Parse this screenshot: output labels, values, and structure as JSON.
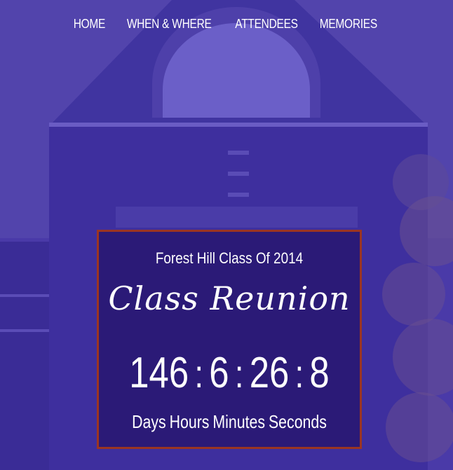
{
  "nav": {
    "items": [
      {
        "label": "HOME"
      },
      {
        "label": "WHEN & WHERE"
      },
      {
        "label": "ATTENDEES"
      },
      {
        "label": "MEMORIES"
      }
    ]
  },
  "hero": {
    "subtitle": "Forest Hill Class Of 2014",
    "title": "Class Reunion",
    "countdown": {
      "days": "146",
      "hours": "6",
      "minutes": "26",
      "seconds": "8",
      "separator": ":",
      "labels": {
        "days": "Days",
        "hours": "Hours",
        "minutes": "Minutes",
        "seconds": "Seconds"
      }
    }
  },
  "colors": {
    "overlay": "#3a2a9a",
    "box_border": "#9b3522",
    "text": "#ffffff"
  }
}
